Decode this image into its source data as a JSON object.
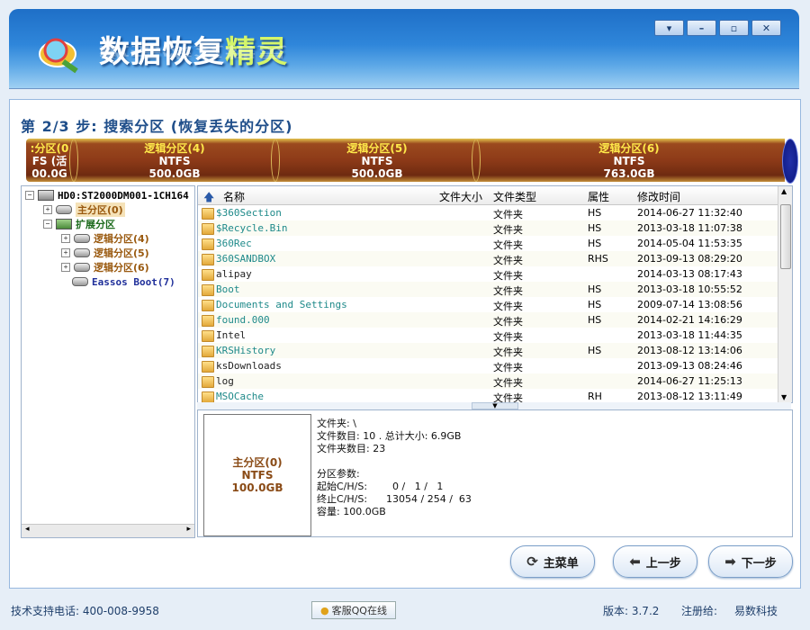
{
  "app": {
    "title_part1": "数据恢复",
    "title_part2": "精灵"
  },
  "window_controls": [
    "▾",
    "–",
    "▫",
    "✕"
  ],
  "step": {
    "title": "第 2/3 步: 搜索分区 (恢复丢失的分区)"
  },
  "partition_bar": [
    {
      "name": ":分区(0",
      "fs": "FS (活",
      "size": "00.0G"
    },
    {
      "name": "逻辑分区(4)",
      "fs": "NTFS",
      "size": "500.0GB"
    },
    {
      "name": "逻辑分区(5)",
      "fs": "NTFS",
      "size": "500.0GB"
    },
    {
      "name": "逻辑分区(6)",
      "fs": "NTFS",
      "size": "763.0GB"
    }
  ],
  "tree": {
    "disk": "HD0:ST2000DM001-1CH164",
    "primary": "主分区(0)",
    "extended": "扩展分区",
    "logicals": [
      "逻辑分区(4)",
      "逻辑分区(5)",
      "逻辑分区(6)"
    ],
    "boot": "Eassos Boot(7)"
  },
  "files": {
    "headers": {
      "name": "名称",
      "size": "文件大小",
      "type": "文件类型",
      "attr": "属性",
      "mtime": "修改时间"
    },
    "rows": [
      {
        "name": "$360Section",
        "type": "文件夹",
        "attr": "HS",
        "mtime": "2014-06-27 11:32:40"
      },
      {
        "name": "$Recycle.Bin",
        "type": "文件夹",
        "attr": "HS",
        "mtime": "2013-03-18 11:07:38"
      },
      {
        "name": "360Rec",
        "type": "文件夹",
        "attr": "HS",
        "mtime": "2014-05-04 11:53:35"
      },
      {
        "name": "360SANDBOX",
        "type": "文件夹",
        "attr": "RHS",
        "mtime": "2013-09-13 08:29:20"
      },
      {
        "name": "alipay",
        "type": "文件夹",
        "attr": "",
        "mtime": "2014-03-13 08:17:43"
      },
      {
        "name": "Boot",
        "type": "文件夹",
        "attr": "HS",
        "mtime": "2013-03-18 10:55:52"
      },
      {
        "name": "Documents and Settings",
        "type": "文件夹",
        "attr": "HS",
        "mtime": "2009-07-14 13:08:56"
      },
      {
        "name": "found.000",
        "type": "文件夹",
        "attr": "HS",
        "mtime": "2014-02-21 14:16:29"
      },
      {
        "name": "Intel",
        "type": "文件夹",
        "attr": "",
        "mtime": "2013-03-18 11:44:35"
      },
      {
        "name": "KRSHistory",
        "type": "文件夹",
        "attr": "HS",
        "mtime": "2013-08-12 13:14:06"
      },
      {
        "name": "ksDownloads",
        "type": "文件夹",
        "attr": "",
        "mtime": "2013-09-13 08:24:46"
      },
      {
        "name": "log",
        "type": "文件夹",
        "attr": "",
        "mtime": "2014-06-27 11:25:13"
      },
      {
        "name": "MSOCache",
        "type": "文件夹",
        "attr": "RH",
        "mtime": "2013-08-12 13:11:49"
      }
    ]
  },
  "detail": {
    "box_name": "主分区(0)",
    "box_fs": "NTFS",
    "box_size": "100.0GB",
    "folder_line": "文件夹: \\",
    "counts_line": "文件数目: 10 . 总计大小: 6.9GB",
    "dirs_line": "文件夹数目: 23",
    "params_title": "分区参数:",
    "start_line": "起始C/H/S:        0 /   1 /   1",
    "end_line": "终止C/H/S:      13054 / 254 /  63",
    "capacity_line": "容量: 100.0GB"
  },
  "buttons": {
    "main_menu": "主菜单",
    "prev": "上一步",
    "next": "下一步"
  },
  "status": {
    "support": "技术支持电话: 400-008-9958",
    "qq": "客服QQ在线",
    "version": "版本: 3.7.2",
    "registered_label": "注册给:",
    "registered_to": "易数科技"
  }
}
